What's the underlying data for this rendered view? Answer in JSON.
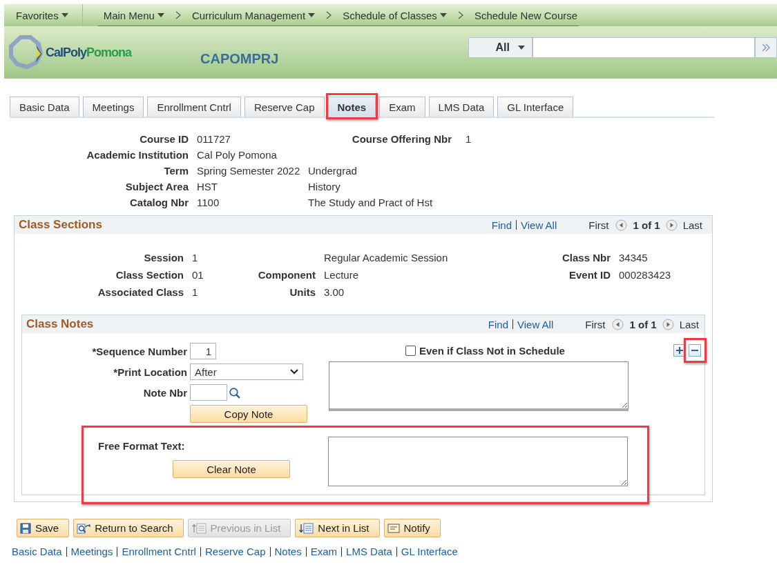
{
  "nav": {
    "favorites": "Favorites",
    "highlighted": true,
    "breadcrumbs": [
      {
        "label": "Main Menu",
        "dropdown": true
      },
      {
        "label": "Curriculum Management",
        "dropdown": true
      },
      {
        "label": "Schedule of Classes",
        "dropdown": true
      },
      {
        "label": "Schedule New Course",
        "dropdown": false
      }
    ]
  },
  "header": {
    "logo_text": "CalPoly",
    "logo_accent": "Pomona",
    "title": "CAPOMPRJ",
    "search": {
      "scope": "All"
    }
  },
  "tabs": [
    {
      "label": "Basic Data",
      "selected": false,
      "highlighted": false
    },
    {
      "label": "Meetings",
      "selected": false,
      "highlighted": false
    },
    {
      "label": "Enrollment Cntrl",
      "selected": false,
      "highlighted": false
    },
    {
      "label": "Reserve Cap",
      "selected": false,
      "highlighted": false
    },
    {
      "label": "Notes",
      "selected": true,
      "highlighted": true
    },
    {
      "label": "Exam",
      "selected": false,
      "highlighted": false
    },
    {
      "label": "LMS Data",
      "selected": false,
      "highlighted": false
    },
    {
      "label": "GL Interface",
      "selected": false,
      "highlighted": false
    }
  ],
  "course": {
    "fields": [
      {
        "label": "Course ID",
        "value": "011727"
      },
      {
        "label": "Academic Institution",
        "value": "Cal Poly Pomona"
      },
      {
        "label": "Term",
        "value": "Spring Semester 2022",
        "description": "Undergrad"
      },
      {
        "label": "Subject Area",
        "value": "HST",
        "description": "History"
      },
      {
        "label": "Catalog Nbr",
        "value": "1100",
        "description": "The Study and Pract of Hst"
      }
    ],
    "offering": {
      "label": "Course Offering Nbr",
      "value": "1"
    }
  },
  "class_sections": {
    "title": "Class Sections",
    "nav": {
      "find": "Find",
      "view_all": "View All",
      "first": "First",
      "count": "1 of 1",
      "last": "Last"
    },
    "rows": [
      [
        {
          "label": "Session",
          "value": "1"
        },
        {
          "value": "Regular Academic Session"
        },
        {
          "label": "Class Nbr",
          "value": "34345"
        }
      ],
      [
        {
          "label": "Class Section",
          "value": "01"
        },
        {
          "label": "Component",
          "value": "Lecture"
        },
        {
          "label": "Event ID",
          "value": "000283423"
        }
      ],
      [
        {
          "label": "Associated Class",
          "value": "1"
        },
        {
          "label": "Units",
          "value": "3.00"
        }
      ]
    ]
  },
  "class_notes": {
    "title": "Class Notes",
    "nav": {
      "find": "Find",
      "view_all": "View All",
      "first": "First",
      "count": "1 of 1",
      "last": "Last"
    },
    "remove_highlighted": true,
    "sequence_label": "*Sequence Number",
    "sequence_value": "1",
    "print_location_label": "*Print Location",
    "print_location_value": "After",
    "note_nbr_label": "Note Nbr",
    "copy_note": "Copy Note",
    "even_if_not_scheduled": {
      "label": "Even if Class Not in Schedule",
      "checked": false
    },
    "free_format": {
      "label": "Free Format Text:",
      "button": "Clear Note",
      "highlighted": true
    }
  },
  "actions": [
    {
      "label": "Save",
      "kind": "save",
      "disabled": false
    },
    {
      "label": "Return to Search",
      "kind": "return",
      "disabled": false
    },
    {
      "label": "Previous in List",
      "kind": "previous",
      "disabled": true
    },
    {
      "label": "Next in List",
      "kind": "next",
      "disabled": false
    },
    {
      "label": "Notify",
      "kind": "notify",
      "disabled": false
    }
  ],
  "links": [
    "Basic Data",
    "Meetings",
    "Enrollment Cntrl",
    "Reserve Cap",
    "Notes",
    "Exam",
    "LMS Data",
    "GL Interface"
  ]
}
